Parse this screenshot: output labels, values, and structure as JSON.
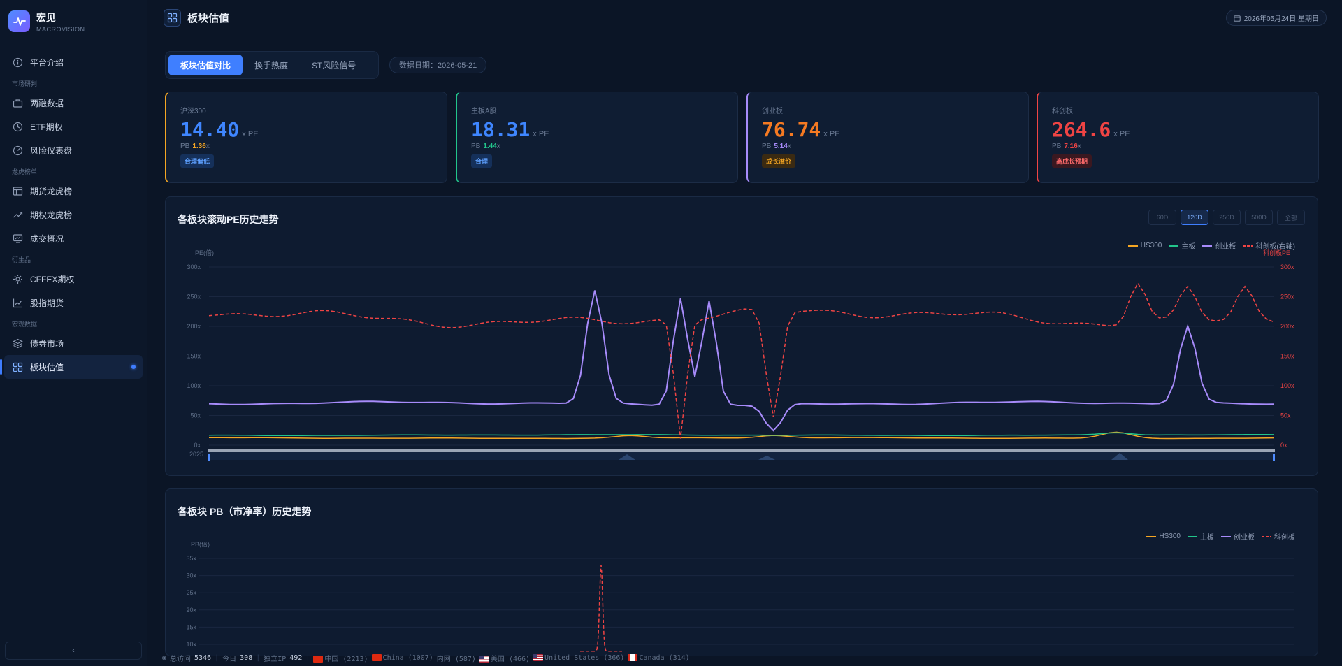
{
  "brand": {
    "name": "宏见",
    "sub": "MACROVISION"
  },
  "nav": {
    "intro": "平台介绍",
    "group1": "市场研判",
    "margin": "两融数据",
    "etf": "ETF期权",
    "risk": "风险仪表盘",
    "group2": "龙虎榜单",
    "futures_rank": "期货龙虎榜",
    "options_rank": "期权龙虎榜",
    "volume": "成交概况",
    "group3": "衍生品",
    "cffex": "CFFEX期权",
    "index_futures": "股指期货",
    "group4": "宏观数据",
    "bond": "债券市场",
    "valuation": "板块估值"
  },
  "header": {
    "title": "板块估值",
    "date": "2026年05月24日 星期日"
  },
  "tabs": [
    "板块估值对比",
    "换手热度",
    "ST风险信号"
  ],
  "data_date": "数据日期：2026-05-21",
  "cards": [
    {
      "label": "沪深300",
      "value": "14.40",
      "unit": "x PE",
      "pb_label": "PB",
      "pb_value": "1.36",
      "pb_unit": "x",
      "tag": "合理偏低",
      "color": "#3f86ff",
      "pb_color": "#f5a623",
      "tag_color": "#5ea0ff",
      "tag_bg": "#15305a",
      "border": "#f5a623"
    },
    {
      "label": "主板A股",
      "value": "18.31",
      "unit": "x PE",
      "pb_label": "PB",
      "pb_value": "1.44",
      "pb_unit": "x",
      "tag": "合理",
      "color": "#3f86ff",
      "pb_color": "#22c58b",
      "tag_color": "#5ea0ff",
      "tag_bg": "#15305a",
      "border": "#22c58b"
    },
    {
      "label": "创业板",
      "value": "76.74",
      "unit": "x PE",
      "pb_label": "PB",
      "pb_value": "5.14",
      "pb_unit": "x",
      "tag": "成长溢价",
      "color": "#f57a22",
      "pb_color": "#a78bfa",
      "tag_color": "#f5a623",
      "tag_bg": "#3a2a12",
      "border": "#a78bfa"
    },
    {
      "label": "科创板",
      "value": "264.6",
      "unit": "x PE",
      "pb_label": "PB",
      "pb_value": "7.16",
      "pb_unit": "x",
      "tag": "高成长预期",
      "color": "#ef4444",
      "pb_color": "#ef4444",
      "tag_color": "#ff6b6b",
      "tag_bg": "#3a1820",
      "border": "#ef4444"
    }
  ],
  "pe_panel": {
    "title": "各板块滚动PE历史走势",
    "ranges": [
      "60D",
      "120D",
      "250D",
      "500D",
      "全部"
    ],
    "active_range": "120D",
    "legend": [
      "HS300",
      "主板",
      "创业板",
      "科创板(右轴)"
    ],
    "y_left_label": "PE(倍)",
    "y_right_label": "科创板PE",
    "y_ticks": [
      "0x",
      "50x",
      "100x",
      "150x",
      "200x",
      "250x",
      "300x"
    ],
    "x_start_label": "2025"
  },
  "pb_panel": {
    "title": "各板块 PB（市净率）历史走势",
    "legend": [
      "HS300",
      "主板",
      "创业板",
      "科创板"
    ],
    "y_label": "PB(倍)",
    "y_ticks": [
      "10x",
      "15x",
      "20x",
      "25x",
      "30x",
      "35x"
    ]
  },
  "colors": {
    "hs300": "#f5a623",
    "main": "#22c58b",
    "gem": "#a78bfa",
    "star": "#ef4444"
  },
  "chart_data": [
    {
      "type": "line",
      "title": "各板块滚动PE历史走势",
      "ylabel": "PE(倍)",
      "y2label": "科创板PE",
      "ylim": [
        0,
        300
      ],
      "y2lim": [
        0,
        300
      ],
      "n_points": 150,
      "series": [
        {
          "name": "HS300",
          "axis": "left",
          "base": 12,
          "spikes": [
            [
              59,
              4,
              2
            ],
            [
              79,
              4,
              2
            ],
            [
              127,
              10,
              2
            ]
          ]
        },
        {
          "name": "主板",
          "axis": "left",
          "base": 17,
          "spikes": [
            [
              127,
              4,
              2
            ]
          ]
        },
        {
          "name": "创业板",
          "axis": "left",
          "base": 70,
          "spikes": [
            [
              54,
              190,
              1.2
            ],
            [
              66,
              180,
              1.0
            ],
            [
              70,
              175,
              1.0
            ],
            [
              79,
              -45,
              1.2
            ],
            [
              137,
              130,
              1.2
            ]
          ]
        },
        {
          "name": "科创板(右轴)",
          "axis": "right",
          "base": 215,
          "spikes": [
            [
              66,
              -200,
              0.8
            ],
            [
              79,
              -180,
              1.0
            ],
            [
              130,
              70,
              1.2
            ],
            [
              137,
              55,
              1.2
            ],
            [
              145,
              55,
              1.2
            ]
          ]
        }
      ]
    },
    {
      "type": "line",
      "title": "各板块 PB（市净率）历史走势",
      "ylabel": "PB(倍)",
      "ylim": [
        10,
        35
      ],
      "series": [
        {
          "name": "科创板",
          "spike_x": 57,
          "spike_y": 33
        }
      ]
    }
  ],
  "footer": {
    "total_label": "总访问",
    "total": "5346",
    "today_label": "今日",
    "today": "308",
    "ip_label": "独立IP",
    "ip": "492",
    "items": [
      {
        "flag": "cn",
        "text": "中国 (2213)"
      },
      {
        "flag": "cn",
        "text": "China (1007)"
      },
      {
        "flag": "",
        "text": "内网 (587)"
      },
      {
        "flag": "us",
        "text": "美国 (466)"
      },
      {
        "flag": "us",
        "text": "United States (366)"
      },
      {
        "flag": "ca",
        "text": "Canada (314)"
      }
    ]
  }
}
